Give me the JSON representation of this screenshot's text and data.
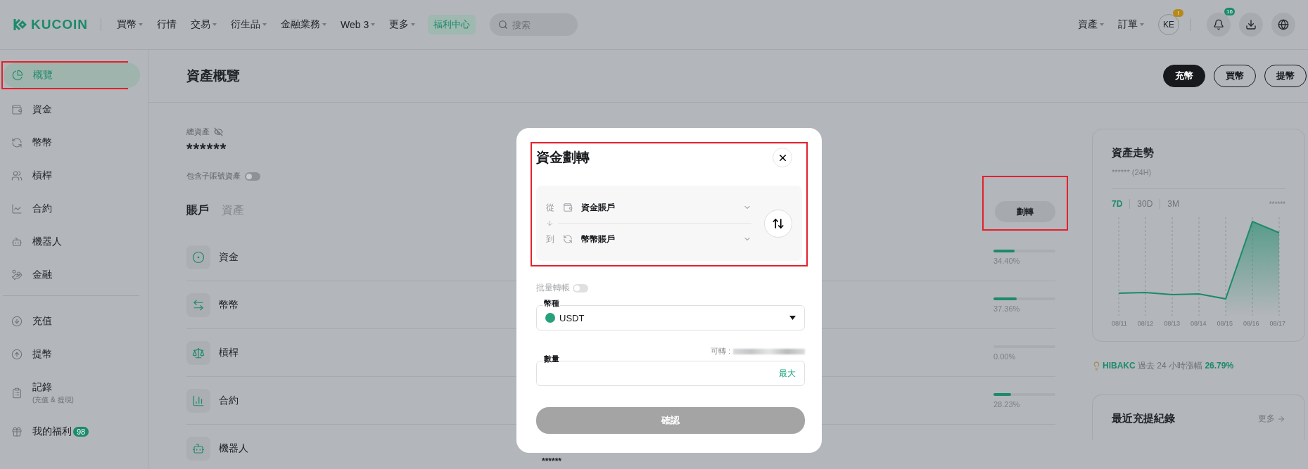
{
  "nav": {
    "logo": "KUCOIN",
    "menu": [
      {
        "label": "買幣",
        "dropdown": true
      },
      {
        "label": "行情",
        "dropdown": false
      },
      {
        "label": "交易",
        "dropdown": true
      },
      {
        "label": "衍生品",
        "dropdown": true
      },
      {
        "label": "金融業務",
        "dropdown": true
      },
      {
        "label": "Web 3",
        "dropdown": true
      },
      {
        "label": "更多",
        "dropdown": true
      }
    ],
    "promo": "福利中心",
    "search": {
      "placeholder": "搜索"
    },
    "right_menu": [
      {
        "label": "資產"
      },
      {
        "label": "訂單"
      }
    ],
    "avatar": {
      "initials": "KE",
      "alert": "!"
    },
    "notifications": {
      "badge": "16"
    }
  },
  "sidebar": {
    "items": [
      {
        "label": "概覽",
        "selected": true,
        "highlighted": true
      },
      {
        "label": "資金",
        "selected": false,
        "highlighted": false
      },
      {
        "label": "幣幣",
        "selected": false,
        "highlighted": false
      },
      {
        "label": "槓桿",
        "selected": false,
        "highlighted": false
      },
      {
        "label": "合約",
        "selected": false,
        "highlighted": false
      },
      {
        "label": "機器人",
        "selected": false,
        "highlighted": false
      },
      {
        "label": "金融",
        "selected": false,
        "highlighted": false
      }
    ],
    "secondary": [
      {
        "label": "充值",
        "selected": false
      },
      {
        "label": "提幣",
        "selected": false
      },
      {
        "label": "記錄",
        "sublabel": "(充值 & 提現)",
        "selected": false
      },
      {
        "label": "我的福利",
        "badge": "98",
        "selected": false
      }
    ]
  },
  "page": {
    "title": "資產概覽",
    "actions": [
      {
        "label": "充幣",
        "primary": true
      },
      {
        "label": "買幣",
        "primary": false
      },
      {
        "label": "提幣",
        "primary": false
      }
    ]
  },
  "summary": {
    "label": "總資產",
    "value": "******",
    "subaccount_toggle": {
      "label": "包含子賬號資產",
      "on": false
    }
  },
  "tabs": [
    {
      "label": "賬戶",
      "selected": true
    },
    {
      "label": "資產",
      "selected": false
    }
  ],
  "transfer_button": {
    "label": "劃轉",
    "highlighted": true
  },
  "accounts": [
    {
      "name": "資金",
      "level": 0.344,
      "reading": "34.40%"
    },
    {
      "name": "幣幣",
      "level": 0.3736,
      "reading": "37.36%"
    },
    {
      "name": "槓桿",
      "level": 0,
      "reading": "0.00%"
    },
    {
      "name": "合約",
      "level": 0.2823,
      "reading": "28.23%"
    },
    {
      "name": "機器人",
      "balance": "******"
    }
  ],
  "trend": {
    "title": "資產走勢",
    "change": "****** (24H)",
    "ranges": [
      {
        "label": "7D",
        "selected": true
      },
      {
        "label": "30D",
        "selected": false
      },
      {
        "label": "3M",
        "selected": false
      }
    ],
    "hidden_value": "******",
    "dates": [
      "08/11",
      "08/12",
      "08/13",
      "08/14",
      "08/15",
      "08/16",
      "08/17"
    ]
  },
  "tip": {
    "coin": "HIBAKC",
    "text": "過去 24 小時漲幅",
    "change": "26.79%"
  },
  "records": {
    "title": "最近充提紀錄",
    "more": "更多"
  },
  "modal": {
    "title": "資金劃轉",
    "highlighted": true,
    "from": {
      "label": "從",
      "account": "資金賬戶"
    },
    "to": {
      "label": "到",
      "account": "幣幣賬戶"
    },
    "batch_toggle": {
      "label": "批量轉帳",
      "on": false
    },
    "coin": {
      "label": "幣種",
      "value": "USDT"
    },
    "available_label": "可轉 :",
    "amount": {
      "label": "數量",
      "max": "最大"
    },
    "confirm": {
      "label": "確認",
      "disabled": true
    }
  }
}
